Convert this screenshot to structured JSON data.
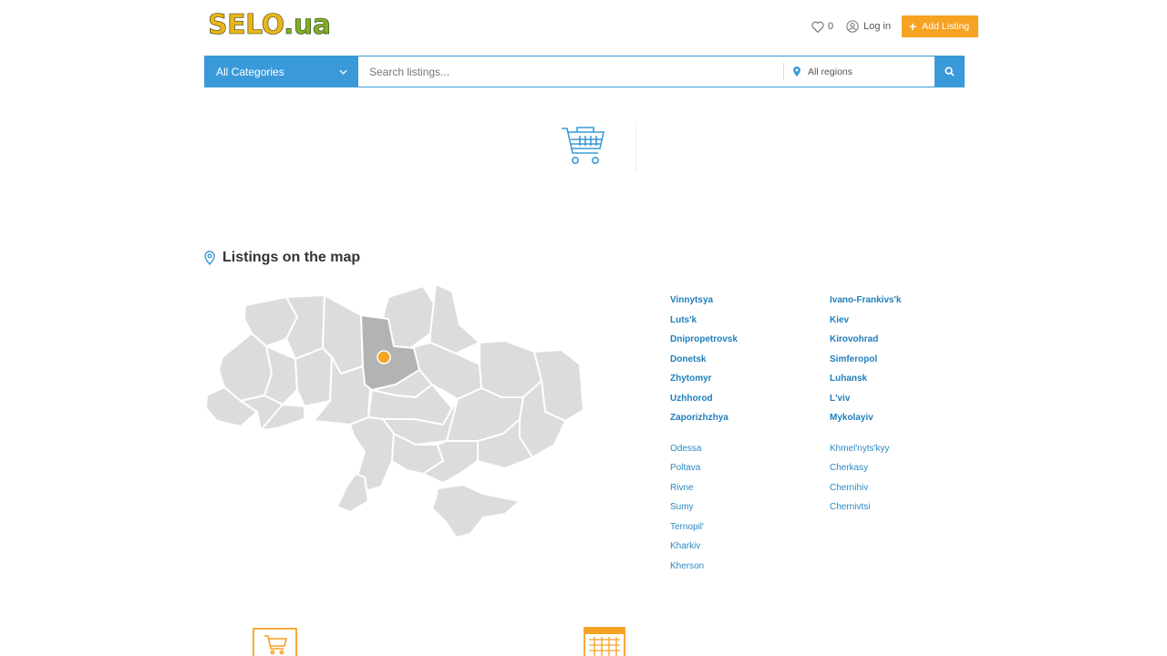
{
  "header": {
    "logo_part1": "SELO",
    "logo_part2": ".ua",
    "favorites_count": "0",
    "login_label": "Log in",
    "add_listing_label": "Add Listing"
  },
  "search": {
    "category_value": "All Categories",
    "placeholder": "Search listings...",
    "region_value": "All regions"
  },
  "map_section": {
    "title": "Listings on the map",
    "regions_bold_col1": [
      "Vinnytsya",
      "Luts'k",
      "Dnipropetrovsk",
      "Donetsk",
      "Zhytomyr",
      "Uzhhorod",
      "Zaporizhzhya"
    ],
    "regions_bold_col2": [
      "Ivano-Frankivs'k",
      "Kiev",
      "Kirovohrad",
      "Simferopol",
      "Luhansk",
      "L'viv",
      "Mykolayiv"
    ],
    "regions_col1": [
      "Odessa",
      "Poltava",
      "Rivne",
      "Sumy",
      "Ternopil'",
      "Kharkiv",
      "Kherson"
    ],
    "regions_col2": [
      "Khmel'nyts'kyy",
      "Cherkasy",
      "Chernihiv",
      "Chernivtsi"
    ]
  },
  "colors": {
    "primary": "#3a9ad9",
    "accent": "#f6a223",
    "link": "#2b8ac4",
    "map_region": "#dcdcdc",
    "map_selected": "#b3b3b3"
  },
  "icons": {
    "favorites": "heart-icon",
    "login": "user-icon",
    "add": "plus-icon",
    "region": "map-pin-icon",
    "search": "search-icon",
    "category": "shopping-cart-icon"
  }
}
